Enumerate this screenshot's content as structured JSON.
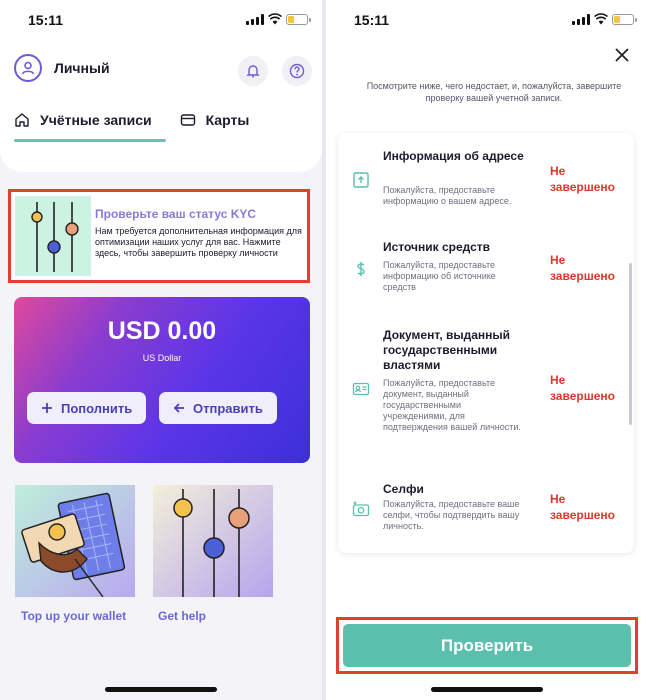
{
  "left_screen": {
    "status_bar": {
      "time": "15:11"
    },
    "profile": {
      "name": "Личный"
    },
    "tabs": [
      {
        "label": "Учётные записи"
      },
      {
        "label": "Карты"
      }
    ],
    "kyc_banner": {
      "title": "Проверьте ваш статус KYC",
      "text": "Нам требуется дополнительная информация для оптимизации наших услуг для вас. Нажмите здесь, чтобы завершить проверку личности"
    },
    "balance": {
      "amount": "USD 0.00",
      "currency": "US Dollar",
      "top_up_label": "Пополнить",
      "send_label": "Отправить"
    },
    "tiles": [
      {
        "label": "Top up your wallet"
      },
      {
        "label": "Get help"
      }
    ]
  },
  "right_screen": {
    "status_bar": {
      "time": "15:11"
    },
    "intro": "Посмотрите ниже, чего недостает, и, пожалуйста, завершите проверку вашей учетной записи.",
    "requirements": [
      {
        "title": "Информация об адресе",
        "description": "Пожалуйста, предоставьте информацию о вашем адресе.",
        "status": "Не завершено",
        "icon": "address-icon"
      },
      {
        "title": "Источник средств",
        "description": "Пожалуйста, предоставьте информацию об источнике средств",
        "status": "Не завершено",
        "icon": "dollar-icon"
      },
      {
        "title": "Документ, выданный государственными властями",
        "description": "Пожалуйста, предоставьте документ, выданный государственными учреждениями, для подтверждения вашей личности.",
        "status": "Не завершено",
        "icon": "id-card-icon"
      },
      {
        "title": "Селфи",
        "description": "Пожалуйста, предоставьте ваше селфи, чтобы подтвердить вашу личность.",
        "status": "Не завершено",
        "icon": "camera-icon"
      }
    ],
    "verify_button_label": "Проверить"
  },
  "colors": {
    "accent_teal": "#5cbfae",
    "accent_purple": "#6c68d6",
    "highlight_red": "#e2402c",
    "status_red": "#e0382c"
  }
}
